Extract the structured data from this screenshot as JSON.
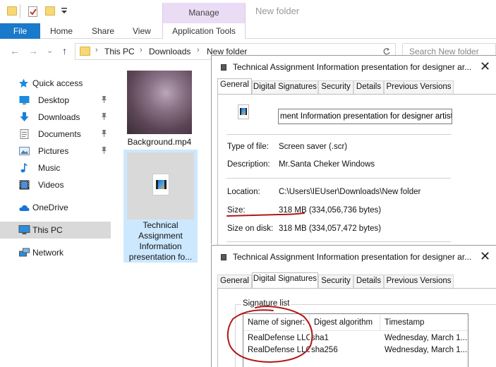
{
  "explorer": {
    "title": "New folder",
    "contextual_tab_group": "Manage",
    "ribbon_tabs": [
      "File",
      "Home",
      "Share",
      "View",
      "Application Tools"
    ],
    "breadcrumb": [
      "This PC",
      "Downloads",
      "New folder"
    ],
    "search_placeholder": "Search New folder",
    "nav": {
      "quick_access": "Quick access",
      "items": [
        {
          "label": "Desktop",
          "icon": "desktop-icon",
          "pinned": true
        },
        {
          "label": "Downloads",
          "icon": "downloads-icon",
          "pinned": true
        },
        {
          "label": "Documents",
          "icon": "documents-icon",
          "pinned": true
        },
        {
          "label": "Pictures",
          "icon": "pictures-icon",
          "pinned": true
        },
        {
          "label": "Music",
          "icon": "music-icon",
          "pinned": false
        },
        {
          "label": "Videos",
          "icon": "videos-icon",
          "pinned": false
        }
      ],
      "onedrive": "OneDrive",
      "this_pc": "This PC",
      "network": "Network"
    },
    "files": [
      {
        "name": "Background.mp4",
        "selected": false
      },
      {
        "name_lines": [
          "Technical",
          "Assignment",
          "Information",
          "presentation fo..."
        ],
        "selected": true
      }
    ]
  },
  "props_general": {
    "title": "Technical Assignment Information presentation for designer ar...",
    "tabs": [
      "General",
      "Digital Signatures",
      "Security",
      "Details",
      "Previous Versions"
    ],
    "active_tab": "General",
    "file_name": "ment Information presentation for designer artist.scr",
    "type_label": "Type of file:",
    "type_value": "Screen saver (.scr)",
    "desc_label": "Description:",
    "desc_value": "Mr.Santa Cheker Windows",
    "location_label": "Location:",
    "location_value": "C:\\Users\\IEUser\\Downloads\\New folder",
    "size_label": "Size:",
    "size_value": "318 MB (334,056,736 bytes)",
    "size_on_disk_label": "Size on disk:",
    "size_on_disk_value": "318 MB (334,057,472 bytes)"
  },
  "props_signatures": {
    "title": "Technical Assignment Information presentation for designer ar...",
    "tabs": [
      "General",
      "Digital Signatures",
      "Security",
      "Details",
      "Previous Versions"
    ],
    "active_tab": "Digital Signatures",
    "group_title": "Signature list",
    "columns": [
      "Name of signer:",
      "Digest algorithm",
      "Timestamp"
    ],
    "rows": [
      [
        "RealDefense LLC",
        "sha1",
        "Wednesday, March 1..."
      ],
      [
        "RealDefense LLC",
        "sha256",
        "Wednesday, March 1..."
      ]
    ]
  },
  "colors": {
    "file_tab": "#1979ca",
    "manage_tab": "#eadcf5",
    "selection": "#cce8ff",
    "annotation": "#b01818"
  },
  "icons": {
    "back": "←",
    "forward": "→",
    "up": "↑",
    "dropdown": "⌄",
    "chevron": "›",
    "close": "✕",
    "pin": "📌"
  }
}
